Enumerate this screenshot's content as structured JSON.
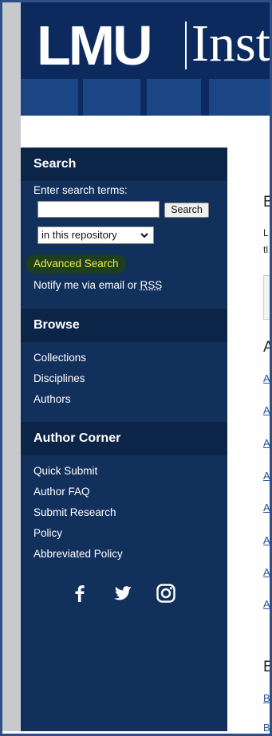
{
  "header": {
    "logo_text": "LMU",
    "logo_subtitle": "Inst"
  },
  "sidebar": {
    "search": {
      "heading": "Search",
      "prompt": "Enter search terms:",
      "input_value": "",
      "button_label": "Search",
      "scope_selected": "in this repository",
      "advanced_label": "Advanced Search",
      "notify_prefix": "Notify me via email or ",
      "rss_label": "RSS"
    },
    "browse": {
      "heading": "Browse",
      "items": [
        "Collections",
        "Disciplines",
        "Authors"
      ]
    },
    "author_corner": {
      "heading": "Author Corner",
      "items": [
        "Quick Submit",
        "Author FAQ",
        "Submit Research",
        "Policy",
        "Abbreviated Policy"
      ]
    },
    "social_icons": [
      "facebook-icon",
      "twitter-icon",
      "instagram-icon"
    ]
  },
  "main": {
    "heading_1": "B",
    "intro_lines": [
      "L",
      "tl"
    ],
    "heading_2": "A",
    "links": [
      "A",
      "A",
      "A",
      "A",
      "A",
      "A",
      "A",
      "A"
    ],
    "heading_3": "B",
    "links_2": [
      "B",
      "B"
    ]
  },
  "colors": {
    "sidebar_bg": "#12305c",
    "section_header_bg": "#0b2447",
    "banner_bg": "#0d2a5e",
    "advanced_search_text": "#f2e84b",
    "highlight": "#1d3f1e"
  }
}
